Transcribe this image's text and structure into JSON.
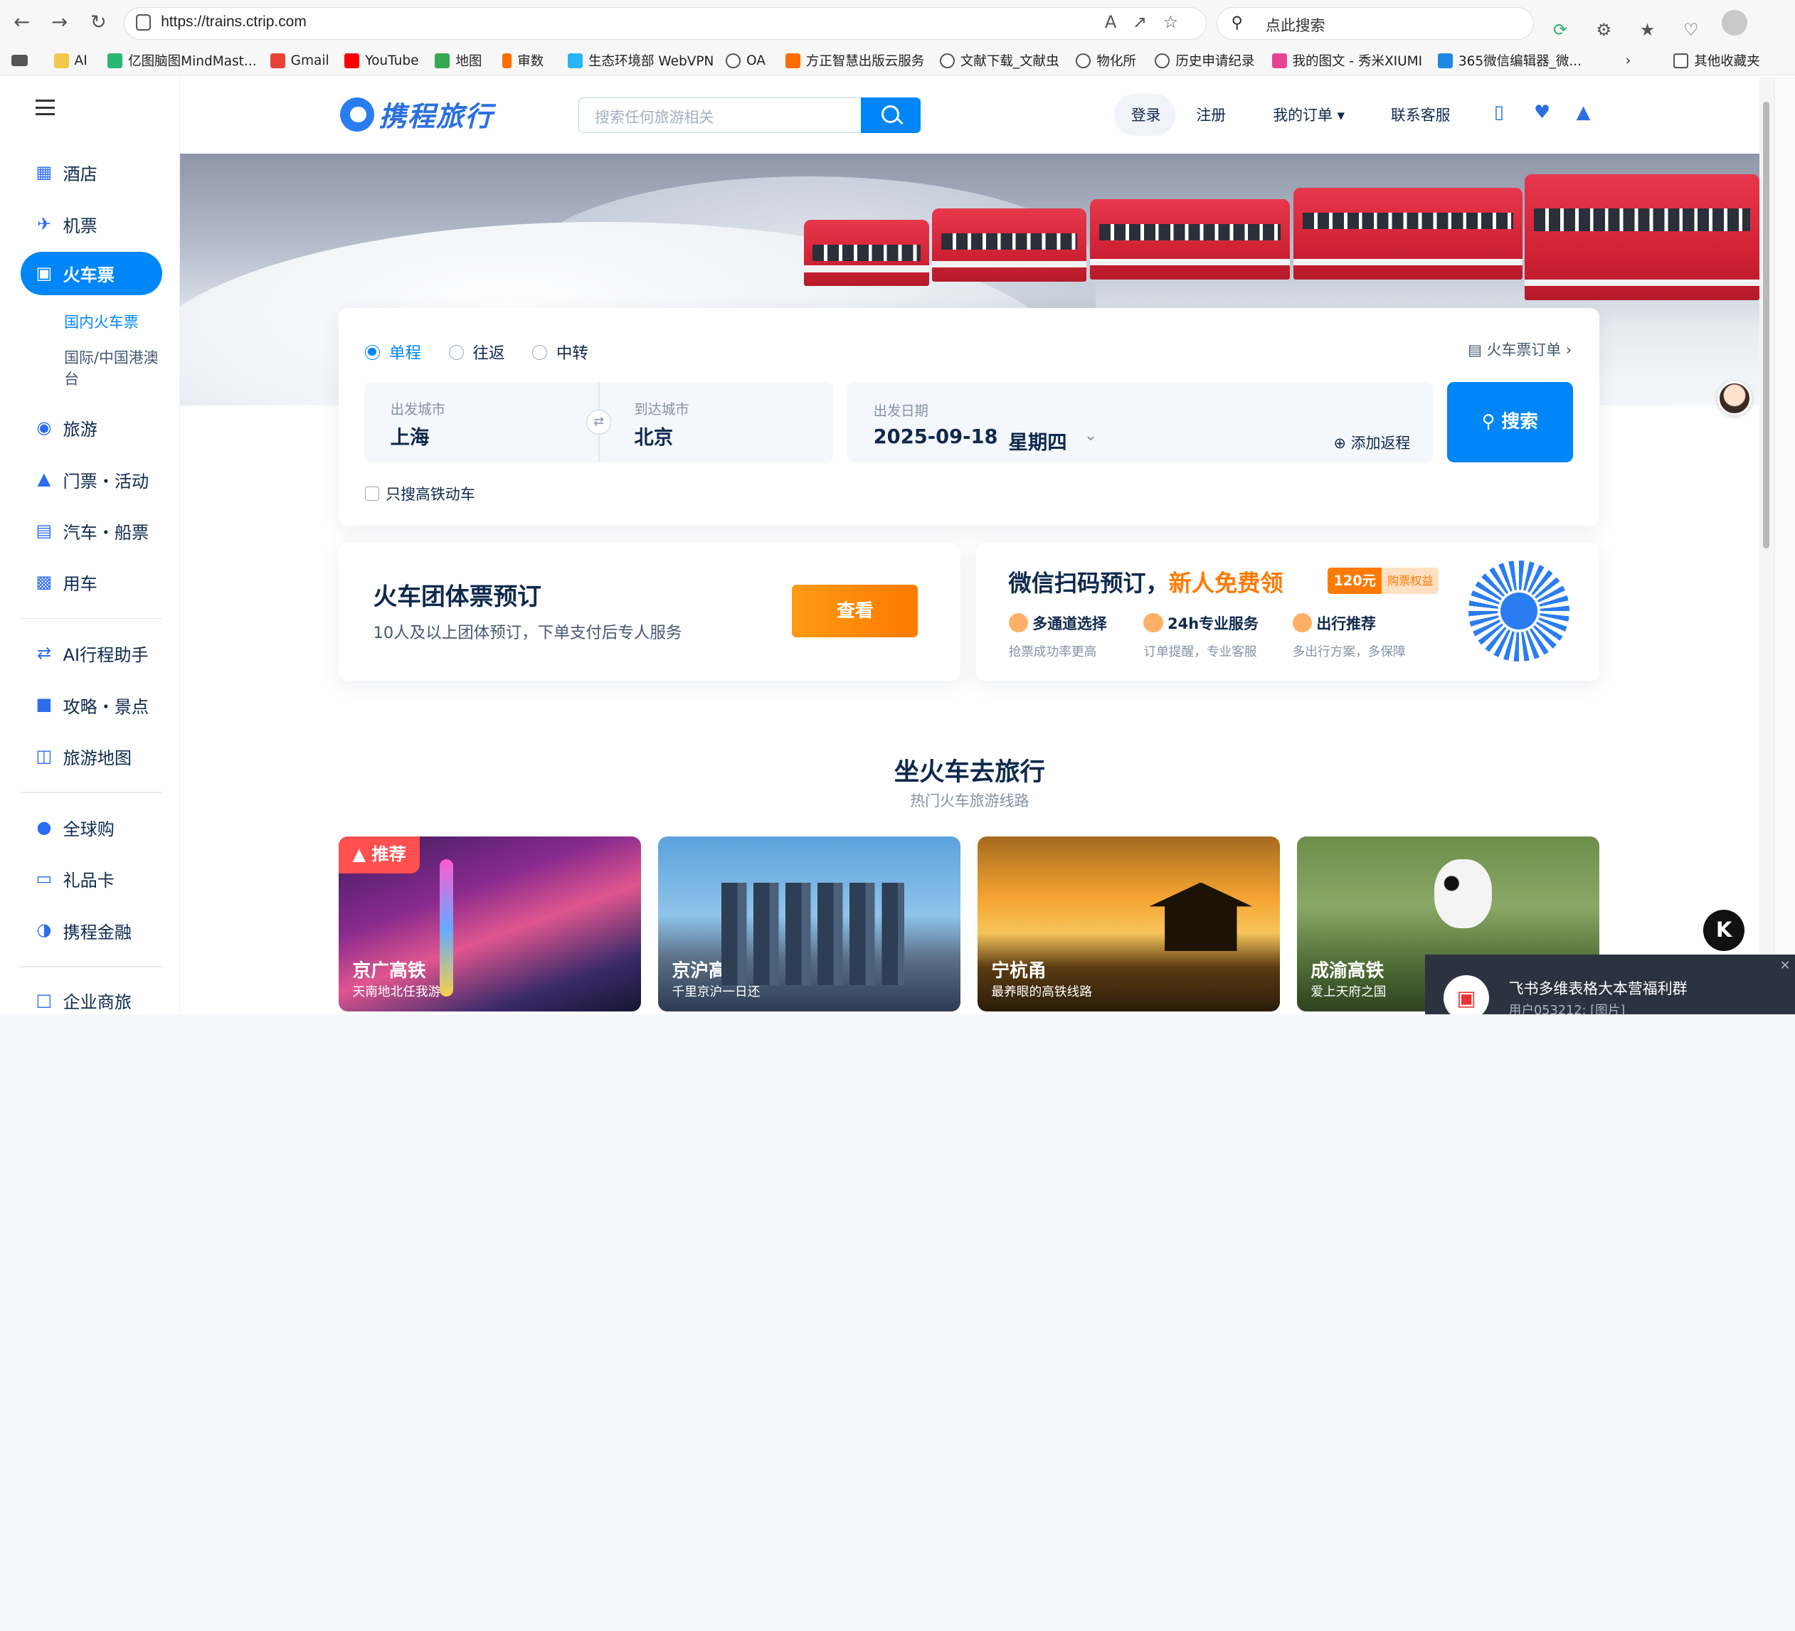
{
  "browser": {
    "url": "https://trains.ctrip.com",
    "search_placeholder": "点此搜索",
    "bookmarks": [
      "AI",
      "亿图脑图MindMast...",
      "Gmail",
      "YouTube",
      "地图",
      "审数",
      "生态环境部 WebVPN",
      "OA",
      "方正智慧出版云服务",
      "文献下载_文献虫",
      "物化所",
      "历史申请纪录",
      "我的图文 - 秀米XIUMI",
      "365微信编辑器_微...",
      "其他收藏夹"
    ]
  },
  "sidebar": {
    "items": [
      {
        "label": "酒店",
        "icon": "hotel-icon"
      },
      {
        "label": "机票",
        "icon": "plane-icon"
      },
      {
        "label": "火车票",
        "icon": "train-icon"
      },
      {
        "label": "旅游",
        "icon": "travel-icon"
      },
      {
        "label": "门票・活动",
        "icon": "ticket-icon"
      },
      {
        "label": "汽车・船票",
        "icon": "bus-icon"
      },
      {
        "label": "用车",
        "icon": "car-icon"
      },
      {
        "label": "AI行程助手",
        "icon": "ai-icon"
      },
      {
        "label": "攻略・景点",
        "icon": "guide-icon"
      },
      {
        "label": "旅游地图",
        "icon": "map-icon"
      },
      {
        "label": "全球购",
        "icon": "globe-icon"
      },
      {
        "label": "礼品卡",
        "icon": "gift-card-icon"
      },
      {
        "label": "携程金融",
        "icon": "finance-icon"
      },
      {
        "label": "企业商旅",
        "icon": "business-icon"
      }
    ],
    "sub_items": [
      "国内火车票",
      "国际/中国港澳台"
    ]
  },
  "header": {
    "logo": "携程旅行",
    "search_placeholder": "搜索任何旅游相关",
    "login": "登录",
    "register": "注册",
    "my_orders": "我的订单",
    "contact": "联系客服"
  },
  "booking": {
    "trip_types": [
      "单程",
      "往返",
      "中转"
    ],
    "train_orders": "火车票订单",
    "from_label": "出发城市",
    "from_value": "上海",
    "to_label": "到达城市",
    "to_value": "北京",
    "date_label": "出发日期",
    "date_value": "2025-09-18",
    "weekday": "星期四",
    "add_return": "添加返程",
    "search": "搜索",
    "high_speed_only": "只搜高铁动车"
  },
  "group": {
    "title": "火车团体票预订",
    "subtitle": "10人及以上团体预订，下单支付后专人服务",
    "button": "查看"
  },
  "wechat": {
    "title": "微信扫码预订，",
    "highlight": "新人免费领",
    "badge_amount": "120元",
    "badge_text": "购票权益",
    "features": [
      {
        "title": "多通道选择",
        "desc": "抢票成功率更高"
      },
      {
        "title": "24h专业服务",
        "desc": "订单提醒，专业客服"
      },
      {
        "title": "出行推荐",
        "desc": "多出行方案，多保障"
      }
    ]
  },
  "section": {
    "title": "坐火车去旅行",
    "subtitle": "热门火车旅游线路",
    "tag": "推荐",
    "routes": [
      {
        "name": "京广高铁",
        "desc": "天南地北任我游"
      },
      {
        "name": "京沪高铁",
        "desc": "千里京沪一日还"
      },
      {
        "name": "宁杭甬",
        "desc": "最养眼的高铁线路"
      },
      {
        "name": "成渝高铁",
        "desc": "爱上天府之国"
      }
    ]
  },
  "toast": {
    "title": "飞书多维表格大本营福利群",
    "message": "用户053212: [图片]"
  }
}
